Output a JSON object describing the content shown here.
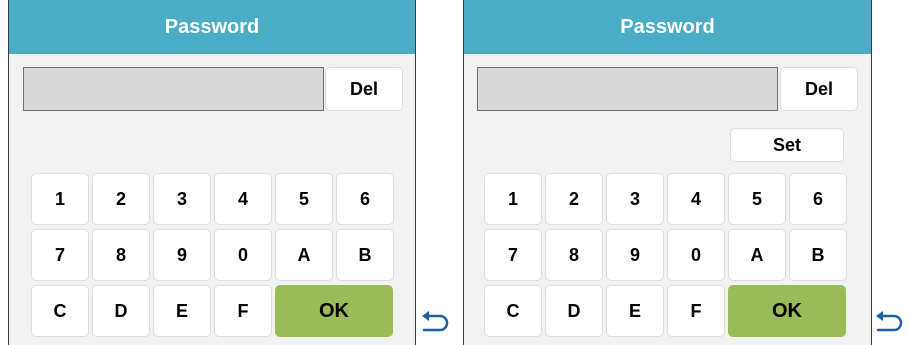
{
  "colors": {
    "title_bar": "#4bacc6",
    "ok_button": "#9bbb59",
    "panel_bg": "#f2f2f2",
    "field_bg": "#d9d9d9",
    "return_icon": "#1f5fa8"
  },
  "left_panel": {
    "title": "Password",
    "password_value": "",
    "del_label": "Del",
    "keys": {
      "k1": "1",
      "k2": "2",
      "k3": "3",
      "k4": "4",
      "k5": "5",
      "k6": "6",
      "k7": "7",
      "k8": "8",
      "k9": "9",
      "k0": "0",
      "kA": "A",
      "kB": "B",
      "kC": "C",
      "kD": "D",
      "kE": "E",
      "kF": "F"
    },
    "ok_label": "OK",
    "back_icon": "return-arrow-icon"
  },
  "right_panel": {
    "title": "Password",
    "password_value": "",
    "del_label": "Del",
    "set_label": "Set",
    "keys": {
      "k1": "1",
      "k2": "2",
      "k3": "3",
      "k4": "4",
      "k5": "5",
      "k6": "6",
      "k7": "7",
      "k8": "8",
      "k9": "9",
      "k0": "0",
      "kA": "A",
      "kB": "B",
      "kC": "C",
      "kD": "D",
      "kE": "E",
      "kF": "F"
    },
    "ok_label": "OK",
    "back_icon": "return-arrow-icon"
  }
}
